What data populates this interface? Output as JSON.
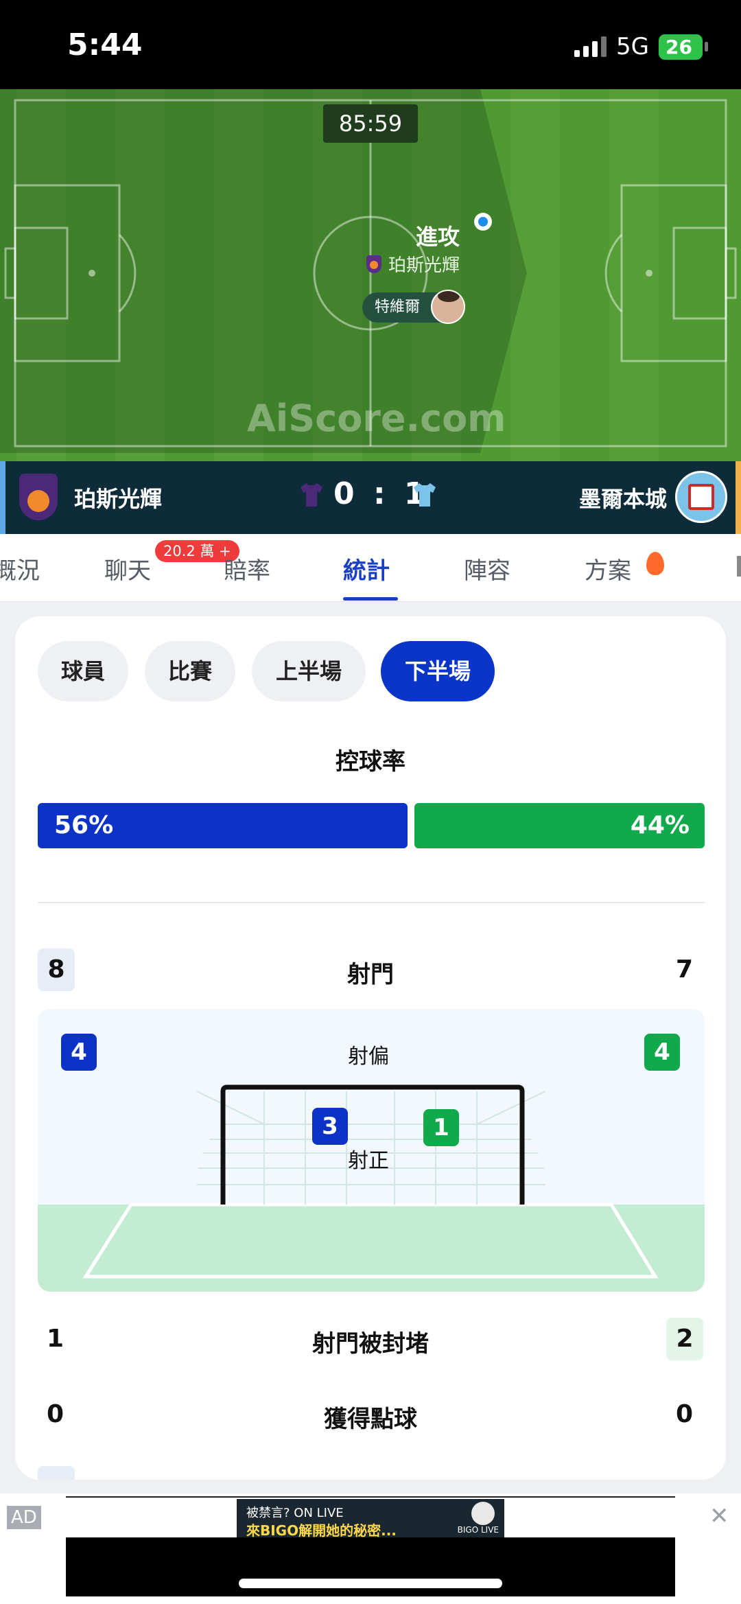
{
  "status_bar": {
    "time": "5:44",
    "network": "5G",
    "battery": "26",
    "colors": {
      "battery": "#2ec24a"
    }
  },
  "pitch": {
    "timer": "85:59",
    "event": "進攻",
    "event_team": "珀斯光輝",
    "player": "特維爾",
    "watermark": "AiScore.com"
  },
  "match": {
    "home_team": "珀斯光輝",
    "away_team": "墨爾本城",
    "home_score": "0",
    "separator": ":",
    "away_score": "1"
  },
  "tabs": {
    "items": [
      "概況",
      "聊天",
      "賠率",
      "統計",
      "陣容",
      "方案"
    ],
    "active": "統計",
    "chat_badge": "20.2 萬 +"
  },
  "filters": {
    "items": [
      "球員",
      "比賽",
      "上半場",
      "下半場"
    ],
    "active": "下半場"
  },
  "stats": {
    "possession": {
      "title": "控球率",
      "home": "56%",
      "away": "44%",
      "home_value": 56,
      "away_value": 44
    },
    "shots": {
      "label": "射門",
      "home": "8",
      "away": "7"
    },
    "shots_off": {
      "label": "射偏",
      "home": "4",
      "away": "4"
    },
    "shots_on": {
      "label": "射正",
      "home": "3",
      "away": "1"
    },
    "blocked": {
      "label": "射門被封堵",
      "home": "1",
      "away": "2"
    },
    "penalties": {
      "label": "獲得點球",
      "home": "0",
      "away": "0"
    }
  },
  "ad": {
    "label": "AD",
    "close": "✕",
    "line1": "被禁言? ON LIVE",
    "line2": "來BIGO解開她的秘密...",
    "brand": "BIGO LIVE"
  },
  "colors": {
    "home": "#0d33c6",
    "away": "#10a94c",
    "accent": "#1a3fc4",
    "pitch": "#4f9a32"
  }
}
